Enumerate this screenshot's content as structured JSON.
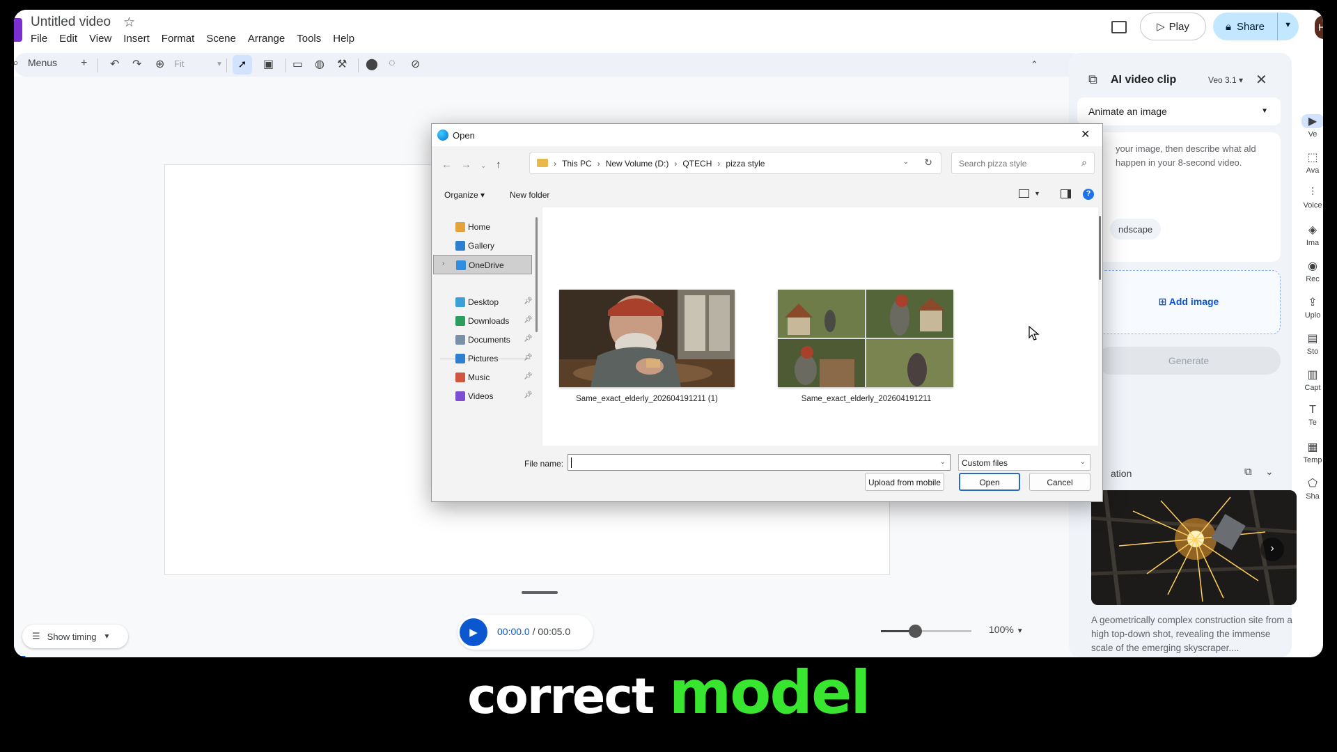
{
  "app": {
    "title": "Untitled video",
    "menu": [
      "File",
      "Edit",
      "View",
      "Insert",
      "Format",
      "Scene",
      "Arrange",
      "Tools",
      "Help"
    ],
    "play_label": "Play",
    "share_label": "Share",
    "avatar_initial": "H"
  },
  "toolbar": {
    "menus_label": "Menus",
    "zoom_select": "Fit"
  },
  "player": {
    "current_time": "00:00.0",
    "separator": " / ",
    "total_time": "00:05.0",
    "show_timing_label": "Show timing",
    "zoom_percent": "100%",
    "zoom_level": 0.38
  },
  "side_panel": {
    "title": "AI video clip",
    "model": "Veo 3.1",
    "mode": "Animate an image",
    "description": "your image, then describe what ald happen in your 8-second video.",
    "chip": "ndscape",
    "add_image": "Add image",
    "generate": "Generate",
    "inspiration_title": "ation",
    "caption": "A geometrically complex construction site from a high top-down shot, revealing the immense scale of the emerging skyscraper...."
  },
  "rail": [
    {
      "label": "Ve",
      "icon": "video-icon",
      "active": true
    },
    {
      "label": "Ava",
      "icon": "avatar-icon",
      "active": false
    },
    {
      "label": "Voice",
      "icon": "voice-icon",
      "active": false
    },
    {
      "label": "Ima",
      "icon": "image-icon",
      "active": false
    },
    {
      "label": "Rec",
      "icon": "record-icon",
      "active": false
    },
    {
      "label": "Uplo",
      "icon": "upload-icon",
      "active": false
    },
    {
      "label": "Sto",
      "icon": "stock-icon",
      "active": false
    },
    {
      "label": "Capt",
      "icon": "captions-icon",
      "active": false
    },
    {
      "label": "Te",
      "icon": "text-icon",
      "active": false
    },
    {
      "label": "Temp",
      "icon": "templates-icon",
      "active": false
    },
    {
      "label": "Sha",
      "icon": "shapes-icon",
      "active": false
    }
  ],
  "dialog": {
    "title": "Open",
    "breadcrumb": [
      "This PC",
      "New Volume (D:)",
      "QTECH",
      "pizza style"
    ],
    "search_placeholder": "Search pizza style",
    "organize": "Organize",
    "new_folder": "New folder",
    "nav_items": [
      {
        "label": "Home",
        "icon": "home-icon",
        "color": "#e3a23a",
        "pinned": false
      },
      {
        "label": "Gallery",
        "icon": "gallery-icon",
        "color": "#2f7fd1",
        "pinned": false
      },
      {
        "label": "OneDrive",
        "icon": "onedrive-icon",
        "color": "#2f8ee0",
        "pinned": false
      },
      {
        "label": "Desktop",
        "icon": "desktop-icon",
        "color": "#3ca0d8",
        "pinned": true
      },
      {
        "label": "Downloads",
        "icon": "downloads-icon",
        "color": "#2a9d5f",
        "pinned": true
      },
      {
        "label": "Documents",
        "icon": "documents-icon",
        "color": "#7a8fa8",
        "pinned": true
      },
      {
        "label": "Pictures",
        "icon": "pictures-icon",
        "color": "#2f7fd1",
        "pinned": true
      },
      {
        "label": "Music",
        "icon": "music-icon",
        "color": "#d2553f",
        "pinned": true
      },
      {
        "label": "Videos",
        "icon": "videos-icon",
        "color": "#7b4fd0",
        "pinned": true
      }
    ],
    "files": [
      {
        "name": "Same_exact_elderly_202604191211 (1)"
      },
      {
        "name": "Same_exact_elderly_202604191211"
      }
    ],
    "file_name_label": "File name:",
    "file_name_value": "",
    "file_type": "Custom files",
    "upload_mobile": "Upload from mobile",
    "open_label": "Open",
    "cancel_label": "Cancel"
  },
  "caption": {
    "word1": "correct",
    "word2": "model"
  }
}
